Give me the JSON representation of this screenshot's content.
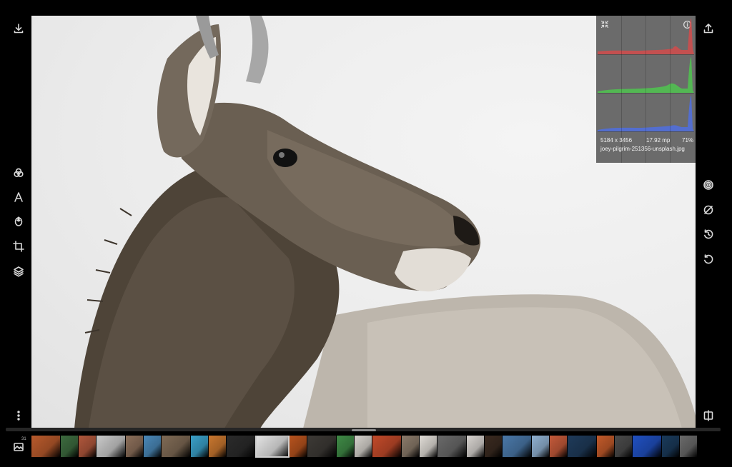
{
  "toolbar_left": {
    "top": [
      {
        "icon": "download-icon"
      }
    ],
    "tools": [
      {
        "icon": "color-adjust-icon"
      },
      {
        "icon": "text-icon"
      },
      {
        "icon": "face-icon"
      },
      {
        "icon": "crop-icon"
      },
      {
        "icon": "layers-icon"
      }
    ],
    "bottom": [
      {
        "icon": "more-vertical-icon"
      }
    ]
  },
  "toolbar_right": {
    "top": [
      {
        "icon": "share-upload-icon"
      }
    ],
    "tools": [
      {
        "icon": "filter-rings-icon"
      },
      {
        "icon": "no-adjust-icon"
      },
      {
        "icon": "rotate-history-icon"
      },
      {
        "icon": "undo-icon"
      }
    ],
    "bottom": [
      {
        "icon": "split-compare-icon"
      }
    ]
  },
  "histogram": {
    "dimensions": "5184 x 3456",
    "megapixels": "17.92 mp",
    "zoom": "71%",
    "filename": "joey-pilgrim-251356-unsplash.jpg",
    "channels": [
      {
        "name": "red",
        "color": "#d24b4b"
      },
      {
        "name": "green",
        "color": "#4fc44f"
      },
      {
        "name": "blue",
        "color": "#4f6ee0"
      }
    ]
  },
  "filmstrip": {
    "count_badge": "31",
    "selected_index": 10,
    "thumbs": [
      "#b85a2c",
      "#3d6b3f",
      "#b0573c",
      "#c9c9c9",
      "#8c6f5a",
      "#4a88b8",
      "#7f6a55",
      "#3aa0c8",
      "#c9772f",
      "#2b2b2b",
      "#e4e4e4",
      "#b7531e",
      "#3d3a36",
      "#3f8a46",
      "#d6d2cc",
      "#c24a2a",
      "#8a7a6a",
      "#e0dcd6",
      "#6a6a6a",
      "#d7d3cf",
      "#3a2a20",
      "#4a78a8",
      "#8fb0d0",
      "#c45a3a",
      "#1f3b5a",
      "#c25a2a",
      "#4a4a4a",
      "#2050c0",
      "#1a3a5a",
      "#6a6a6a"
    ]
  }
}
